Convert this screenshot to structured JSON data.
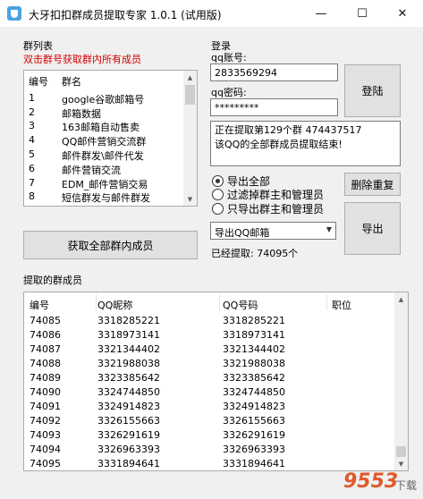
{
  "window": {
    "title": "大牙扣扣群成员提取专家 1.0.1  (试用版)",
    "minimize_glyph": "—",
    "maximize_glyph": "☐",
    "close_glyph": "✕"
  },
  "group_section": {
    "title": "群列表",
    "hint": "双击群号获取群内所有成员",
    "col_number": "编号",
    "col_name": "群名",
    "rows": [
      {
        "no": "1",
        "name": "google谷歌邮箱号"
      },
      {
        "no": "2",
        "name": "邮箱数据"
      },
      {
        "no": "3",
        "name": "163邮箱自动售卖"
      },
      {
        "no": "4",
        "name": "QQ邮件营销交流群"
      },
      {
        "no": "5",
        "name": "邮件群发\\邮件代发"
      },
      {
        "no": "6",
        "name": "邮件营销交流"
      },
      {
        "no": "7",
        "name": "EDM_邮件营销交易"
      },
      {
        "no": "8",
        "name": "短信群发与邮件群发"
      }
    ],
    "fetch_button": "获取全部群内成员"
  },
  "login_section": {
    "title": "登录",
    "account_label": "qq账号:",
    "account_value": "2833569294",
    "password_label": "qq密码:",
    "password_value": "*********",
    "login_button": "登陆",
    "status_text": "正在提取第129个群 474437517\n该QQ的全部群成员提取结束!"
  },
  "export_options": {
    "options": [
      {
        "label": "导出全部",
        "selected": true
      },
      {
        "label": "过滤掉群主和管理员",
        "selected": false
      },
      {
        "label": "只导出群主和管理员",
        "selected": false
      }
    ],
    "dedupe_button": "删除重复",
    "export_select_value": "导出QQ邮箱",
    "export_button": "导出",
    "extracted_label": "已经提取: 74095个"
  },
  "members_section": {
    "title": "提取的群成员",
    "headers": {
      "no": "编号",
      "nick": "QQ昵称",
      "qq": "QQ号码",
      "role": "职位"
    },
    "rows": [
      {
        "no": "74085",
        "nick": "3318285221",
        "qq": "3318285221",
        "role": ""
      },
      {
        "no": "74086",
        "nick": "3318973141",
        "qq": "3318973141",
        "role": ""
      },
      {
        "no": "74087",
        "nick": "3321344402",
        "qq": "3321344402",
        "role": ""
      },
      {
        "no": "74088",
        "nick": "3321988038",
        "qq": "3321988038",
        "role": ""
      },
      {
        "no": "74089",
        "nick": "3323385642",
        "qq": "3323385642",
        "role": ""
      },
      {
        "no": "74090",
        "nick": "3324744850",
        "qq": "3324744850",
        "role": ""
      },
      {
        "no": "74091",
        "nick": "3324914823",
        "qq": "3324914823",
        "role": ""
      },
      {
        "no": "74092",
        "nick": "3326155663",
        "qq": "3326155663",
        "role": ""
      },
      {
        "no": "74093",
        "nick": "3326291619",
        "qq": "3326291619",
        "role": ""
      },
      {
        "no": "74094",
        "nick": "3326963393",
        "qq": "3326963393",
        "role": ""
      },
      {
        "no": "74095",
        "nick": "3331894641",
        "qq": "3331894641",
        "role": ""
      }
    ]
  },
  "watermark": {
    "text": "9553",
    "subtext": "下载"
  },
  "colors": {
    "hint_red": "#d40000",
    "window_bg": "#f0f0f0",
    "button_bg": "#e1e1e1"
  }
}
